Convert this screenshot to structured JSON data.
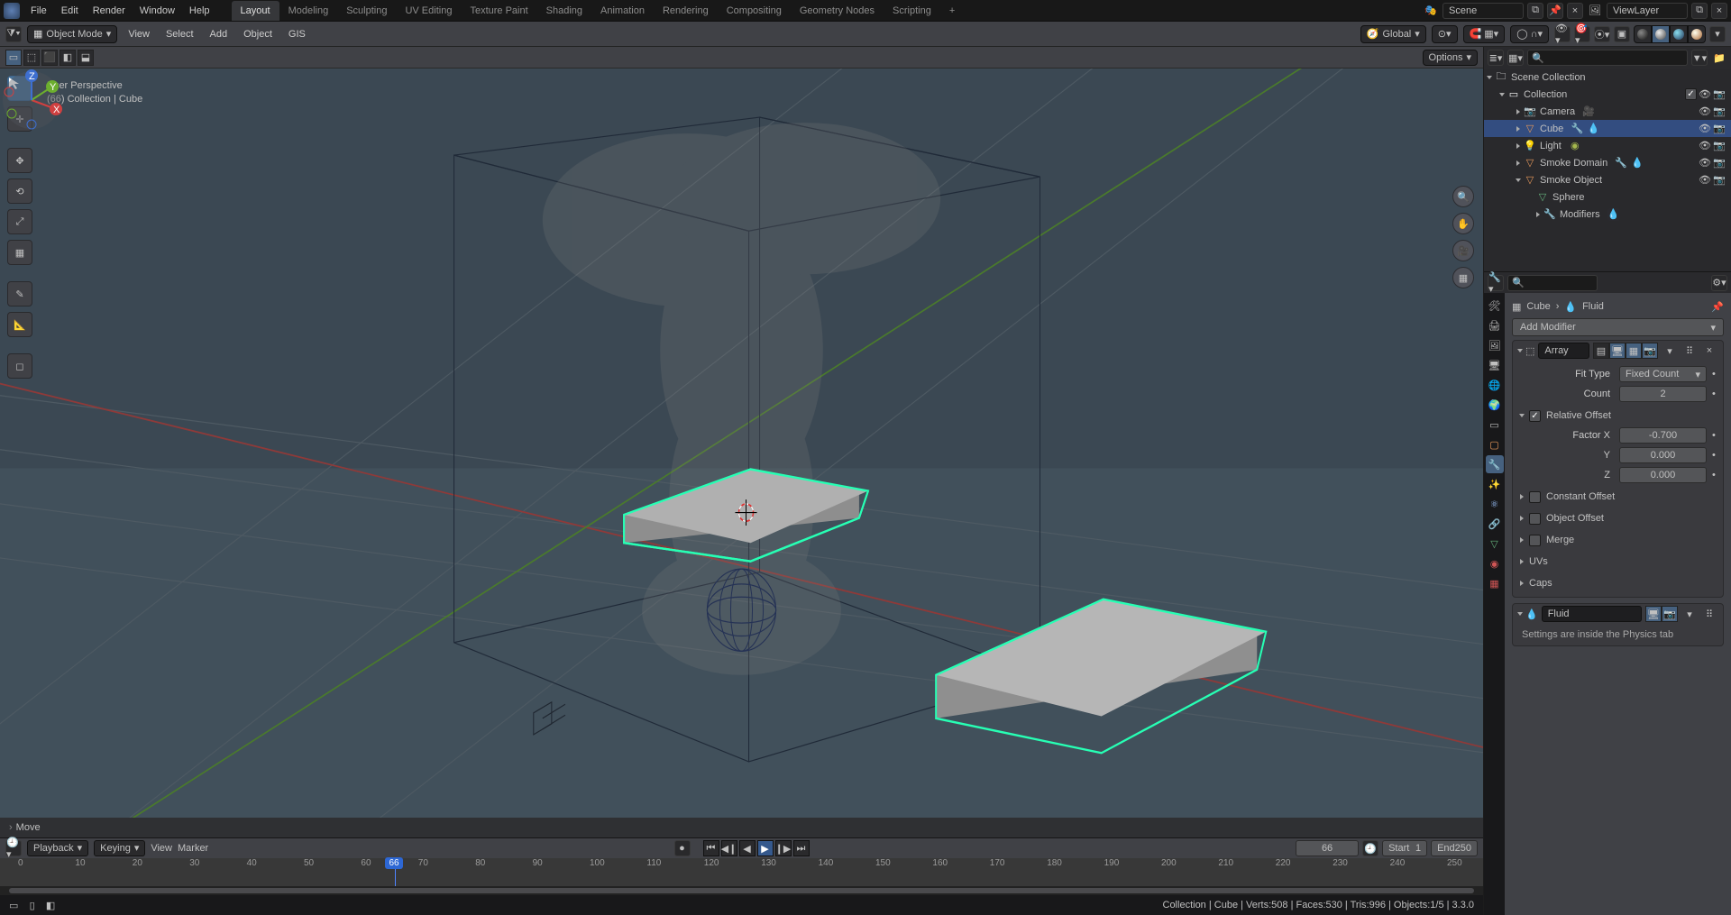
{
  "topbar": {
    "menus": [
      "File",
      "Edit",
      "Render",
      "Window",
      "Help"
    ],
    "workspaces": [
      "Layout",
      "Modeling",
      "Sculpting",
      "UV Editing",
      "Texture Paint",
      "Shading",
      "Animation",
      "Rendering",
      "Compositing",
      "Geometry Nodes",
      "Scripting"
    ],
    "active_ws": "Layout",
    "scene_label": "Scene",
    "viewlayer_label": "ViewLayer"
  },
  "header2": {
    "mode": "Object Mode",
    "menus": [
      "View",
      "Select",
      "Add",
      "Object",
      "GIS"
    ],
    "orient": "Global"
  },
  "header3": {
    "options": "Options"
  },
  "viewport": {
    "persp": "User Perspective",
    "context": "(66) Collection | Cube",
    "footer_last_op": "Move",
    "gizmo": {
      "x": "X",
      "y": "Y",
      "z": "Z"
    }
  },
  "timeline": {
    "menus": [
      "Playback",
      "Keying",
      "View",
      "Marker"
    ],
    "current": 66,
    "start_label": "Start",
    "start": 1,
    "end_label": "End",
    "end": 250,
    "ticks": [
      0,
      10,
      20,
      30,
      40,
      50,
      60,
      70,
      80,
      90,
      100,
      110,
      120,
      130,
      140,
      150,
      160,
      170,
      180,
      190,
      200,
      210,
      220,
      230,
      240,
      250
    ]
  },
  "status": {
    "right": "Collection | Cube | Verts:508 | Faces:530 | Tris:996 | Objects:1/5 | 3.3.0"
  },
  "outliner": {
    "root": "Scene Collection",
    "collection": "Collection",
    "items": [
      {
        "name": "Camera",
        "type": "camera"
      },
      {
        "name": "Cube",
        "type": "mesh",
        "selected": true,
        "extra": [
          "wrench",
          "drop"
        ]
      },
      {
        "name": "Light",
        "type": "light"
      },
      {
        "name": "Smoke Domain",
        "type": "mesh",
        "extra": [
          "wrench",
          "drop"
        ]
      },
      {
        "name": "Smoke Object",
        "type": "mesh",
        "expanded": true,
        "children": [
          {
            "name": "Sphere",
            "type": "meshdata"
          },
          {
            "name": "Modifiers",
            "type": "modifiers"
          }
        ]
      }
    ]
  },
  "properties": {
    "breadcrumb": {
      "obj": "Cube",
      "mod": "Fluid"
    },
    "add_modifier": "Add Modifier",
    "array": {
      "name": "Array",
      "fit_label": "Fit Type",
      "fit_value": "Fixed Count",
      "count_label": "Count",
      "count_value": 2,
      "relative_offset": "Relative Offset",
      "factor_x_label": "Factor X",
      "factor_x": "-0.700",
      "y_label": "Y",
      "y": "0.000",
      "z_label": "Z",
      "z": "0.000",
      "sections": [
        "Constant Offset",
        "Object Offset",
        "Merge",
        "UVs",
        "Caps"
      ]
    },
    "fluid": {
      "name": "Fluid",
      "info": "Settings are inside the Physics tab"
    }
  }
}
